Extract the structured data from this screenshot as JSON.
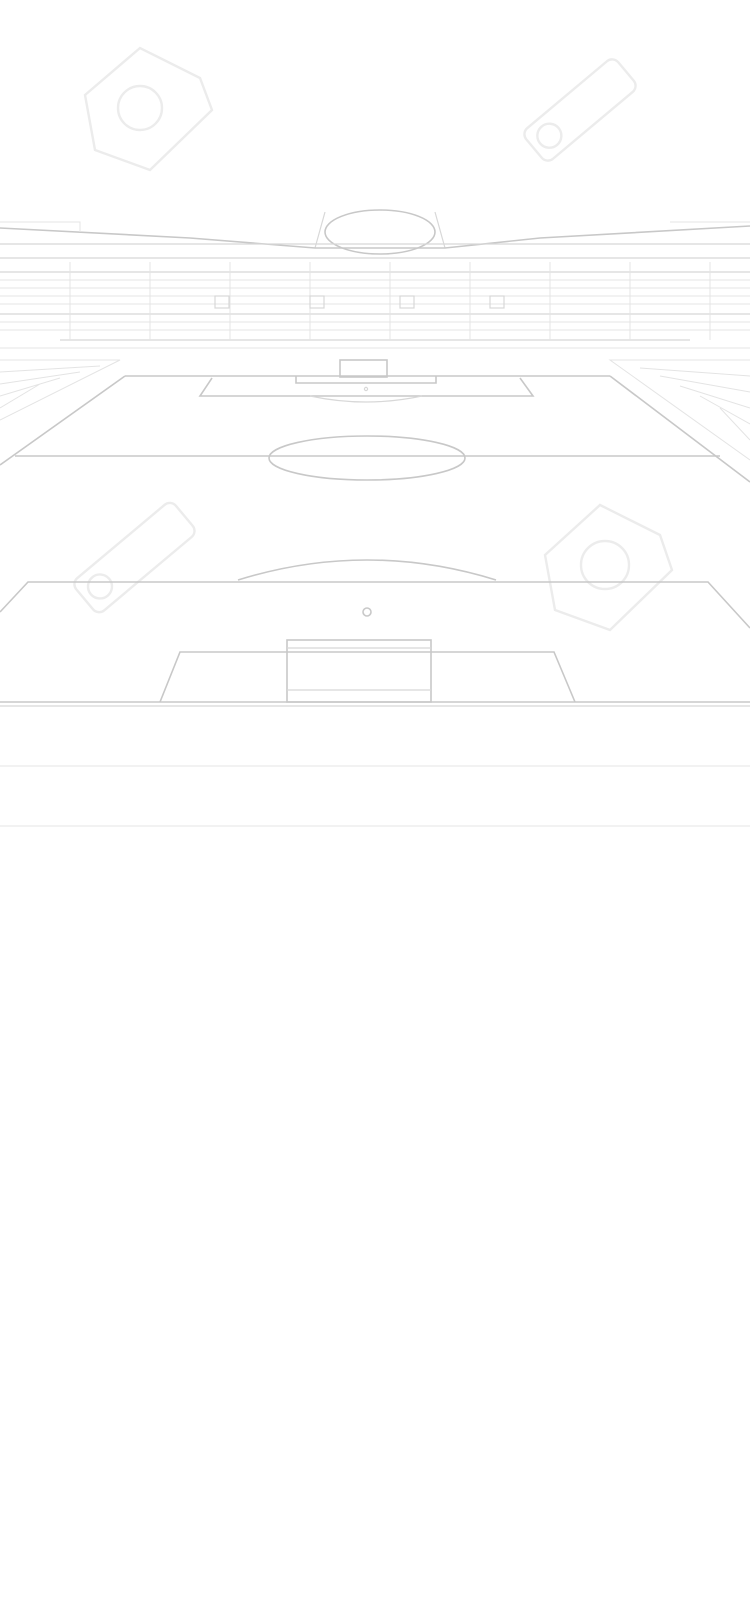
{
  "background_color": "#ffffff",
  "line_color": "#c8c8c8",
  "watermark_logo_name": "123rf-watermark-logo"
}
